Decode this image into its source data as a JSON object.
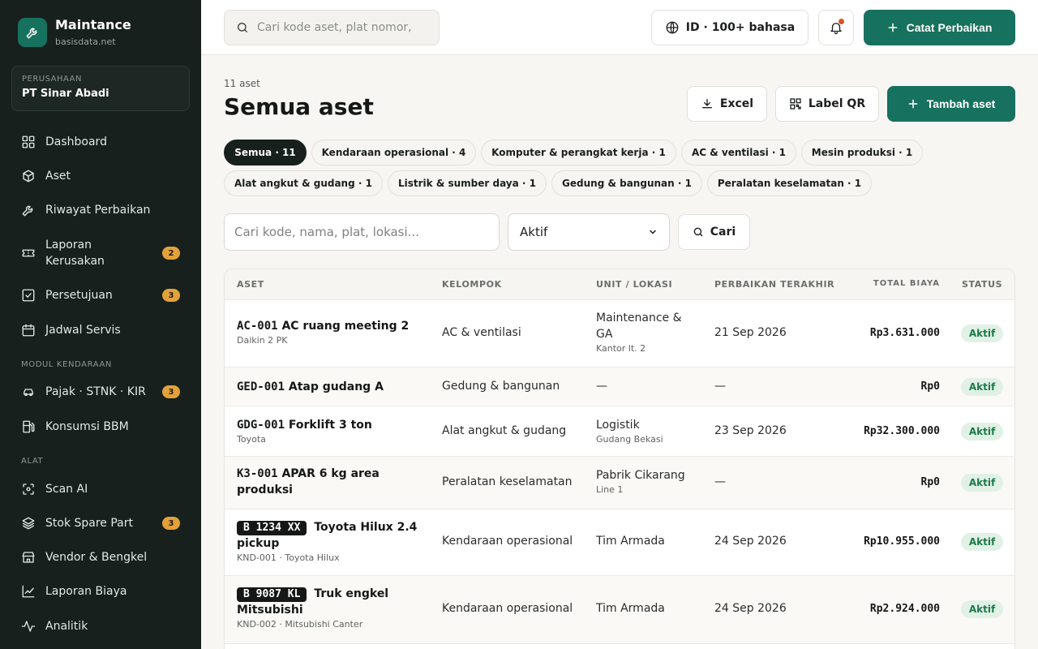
{
  "sidebar": {
    "brand_title": "Maintance",
    "brand_subtitle": "basisdata.net",
    "company_label": "PERUSAHAAN",
    "company_name": "PT Sinar Abadi",
    "items": [
      {
        "label": "Dashboard",
        "icon": "grid-icon"
      },
      {
        "label": "Aset",
        "icon": "cube-icon"
      },
      {
        "label": "Riwayat Perbaikan",
        "icon": "wrench-icon"
      },
      {
        "label": "Laporan Kerusakan",
        "icon": "ticket-icon",
        "badge": "2"
      },
      {
        "label": "Persetujuan",
        "icon": "check-square-icon",
        "badge": "3"
      },
      {
        "label": "Jadwal Servis",
        "icon": "calendar-icon"
      },
      {
        "label": "Pajak · STNK · KIR",
        "icon": "car-icon",
        "badge": "3"
      },
      {
        "label": "Konsumsi BBM",
        "icon": "fuel-icon"
      },
      {
        "label": "Scan AI",
        "icon": "scan-icon"
      },
      {
        "label": "Stok Spare Part",
        "icon": "layers-icon",
        "badge": "3"
      },
      {
        "label": "Vendor & Bengkel",
        "icon": "store-icon"
      },
      {
        "label": "Laporan Biaya",
        "icon": "line-chart-icon"
      },
      {
        "label": "Analitik",
        "icon": "activity-icon"
      }
    ],
    "section_vehicle": "MODUL KENDARAAN",
    "section_tools": "ALAT"
  },
  "topbar": {
    "search_placeholder": "Cari kode aset, plat nomor,",
    "language": "ID · 100+ bahasa",
    "catat_label": "Catat Perbaikan"
  },
  "main": {
    "count": "11 aset",
    "title": "Semua aset",
    "excel_label": "Excel",
    "qr_label": "Label QR",
    "add_label": "Tambah aset",
    "chips": [
      "Semua · 11",
      "Kendaraan operasional · 4",
      "Komputer & perangkat kerja · 1",
      "AC & ventilasi · 1",
      "Mesin produksi · 1",
      "Alat angkut & gudang · 1",
      "Listrik & sumber daya · 1",
      "Gedung & bangunan · 1",
      "Peralatan keselamatan · 1"
    ],
    "filter_placeholder": "Cari kode, nama, plat, lokasi...",
    "status_selected": "Aktif",
    "search_button": "Cari"
  },
  "table": {
    "headers": [
      "ASET",
      "KELOMPOK",
      "UNIT / LOKASI",
      "PERBAIKAN TERAKHIR",
      "TOTAL BIAYA",
      "STATUS"
    ],
    "rows": [
      {
        "code": "AC-001",
        "name": "AC ruang meeting 2",
        "sub": "Daikin 2 PK",
        "group": "AC & ventilasi",
        "unit": "Maintenance & GA",
        "location": "Kantor lt. 2",
        "last": "21 Sep 2026",
        "cost": "Rp3.631.000",
        "status": "Aktif"
      },
      {
        "code": "GED-001",
        "name": "Atap gudang A",
        "sub": "",
        "group": "Gedung & bangunan",
        "unit": "—",
        "location": "",
        "last": "—",
        "cost": "Rp0",
        "status": "Aktif"
      },
      {
        "code": "GDG-001",
        "name": "Forklift 3 ton",
        "sub": "Toyota",
        "group": "Alat angkut & gudang",
        "unit": "Logistik",
        "location": "Gudang Bekasi",
        "last": "23 Sep 2026",
        "cost": "Rp32.300.000",
        "status": "Aktif"
      },
      {
        "code": "K3-001",
        "name": "APAR 6 kg area produksi",
        "sub": "",
        "group": "Peralatan keselamatan",
        "unit": "Pabrik Cikarang",
        "location": "Line 1",
        "last": "—",
        "cost": "Rp0",
        "status": "Aktif"
      },
      {
        "plate": "B 1234 XX",
        "name": "Toyota Hilux 2.4 pickup",
        "sub": "KND-001 · Toyota Hilux",
        "group": "Kendaraan operasional",
        "unit": "Tim Armada",
        "location": "",
        "last": "24 Sep 2026",
        "cost": "Rp10.955.000",
        "status": "Aktif"
      },
      {
        "plate": "B 9087 KL",
        "name": "Truk engkel Mitsubishi",
        "sub": "KND-002 · Mitsubishi Canter",
        "group": "Kendaraan operasional",
        "unit": "Tim Armada",
        "location": "",
        "last": "24 Sep 2026",
        "cost": "Rp2.924.000",
        "status": "Aktif"
      }
    ]
  },
  "colors": {
    "sidebar_bg": "#17201c",
    "primary": "#17715f",
    "badge": "#e3a13a",
    "status_bg": "#e1f1e6",
    "status_text": "#1b7a4a"
  }
}
